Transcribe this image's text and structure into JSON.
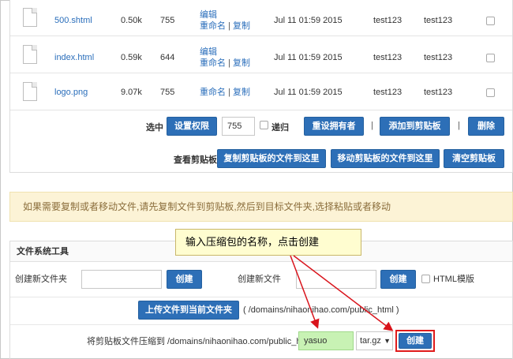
{
  "files": [
    {
      "name": "500.shtml",
      "size": "0.50k",
      "perm": "755",
      "action1": "编辑",
      "action2": "重命名",
      "action3": "复制",
      "modified": "Jul 11 01:59 2015",
      "owner": "test123",
      "group": "test123"
    },
    {
      "name": "index.html",
      "size": "0.59k",
      "perm": "644",
      "action1": "编辑",
      "action2": "重命名",
      "action3": "复制",
      "modified": "Jul 11 01:59 2015",
      "owner": "test123",
      "group": "test123"
    },
    {
      "name": "logo.png",
      "size": "9.07k",
      "perm": "755",
      "action1": "",
      "action2": "重命名",
      "action3": "复制",
      "modified": "Jul 11 01:59 2015",
      "owner": "test123",
      "group": "test123"
    }
  ],
  "action_sep": "|",
  "selection_bar": {
    "label": "选中",
    "set_perm_button": "设置权限",
    "perm_value": "755",
    "recursive_label": "递归",
    "reset_owner_button": "重设拥有者",
    "add_clipboard_button": "添加到剪贴板",
    "delete_button": "删除",
    "sep": "|"
  },
  "clipboard_bar": {
    "label": "查看剪贴板",
    "copy_here_button": "复制剪贴板的文件到这里",
    "move_here_button": "移动剪贴板的文件到这里",
    "clear_button": "清空剪贴板"
  },
  "notice": "如果需要复制或者移动文件,请先复制文件到剪贴板,然后到目标文件夹,选择粘贴或者移动",
  "tools": {
    "title": "文件系统工具",
    "new_folder_label": "创建新文件夹",
    "new_folder_button": "创建",
    "new_file_label": "创建新文件",
    "new_file_button": "创建",
    "html_template_label": "HTML模版",
    "upload_button": "上传文件到当前文件夹",
    "upload_path": "( /domains/nihaonihao.com/public_html )",
    "compress_label": "将剪贴板文件压缩到 /domains/nihaonihao.com/public_html/",
    "compress_name_value": "yasuo",
    "compress_format": "tar.gz",
    "compress_button": "创建"
  },
  "annotation": {
    "text": "输入压缩包的名称，点击创建",
    "arrow_color": "#d9141c",
    "highlight_input_color": "#c8f2b4",
    "highlight_button_border": "#e01b1b"
  },
  "colors": {
    "button_blue": "#2d6fb7",
    "link_blue": "#2a6ebb",
    "notice_bg": "#fcf3d6",
    "notice_text": "#8a6d3b"
  }
}
